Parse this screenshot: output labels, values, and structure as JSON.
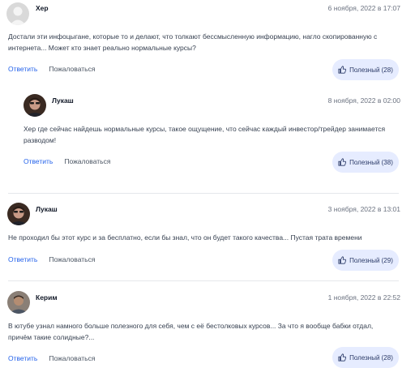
{
  "comments": [
    {
      "author": "Хер",
      "date": "6 ноября, 2022 в 17:07",
      "text": "Достали эти инфоцыгане, которые то и делают, что толкают бессмысленную информацию, нагло скопированную с интернета... Может кто знает реально нормальные курсы?",
      "reply_label": "Ответить",
      "complain_label": "Пожаловаться",
      "useful_label": "Полезный (28)"
    },
    {
      "author": "Лукаш",
      "date": "8 ноября, 2022 в 02:00",
      "text": "Хер где сейчас найдешь нормальные курсы, такое ощущение, что сейчас каждый инвестор/трейдер занимается разводом!",
      "reply_label": "Ответить",
      "complain_label": "Пожаловаться",
      "useful_label": "Полезный (38)"
    },
    {
      "author": "Лукаш",
      "date": "3 ноября, 2022 в 13:01",
      "text": "Не проходил бы этот курс и за бесплатно, если бы знал, что он будет такого качества... Пустая трата времени",
      "reply_label": "Ответить",
      "complain_label": "Пожаловаться",
      "useful_label": "Полезный (29)"
    },
    {
      "author": "Керим",
      "date": "1 ноября, 2022 в 22:52",
      "text": "В ютубе узнал намного больше полезного для себя, чем с её бестолковых курсов... За что я вообще бабки отдал, причём такие солидные?...",
      "reply_label": "Ответить",
      "complain_label": "Пожаловаться",
      "useful_label": "Полезный (28)"
    }
  ],
  "colors": {
    "accent": "#2563eb",
    "useful_bg": "#e6ecff"
  }
}
